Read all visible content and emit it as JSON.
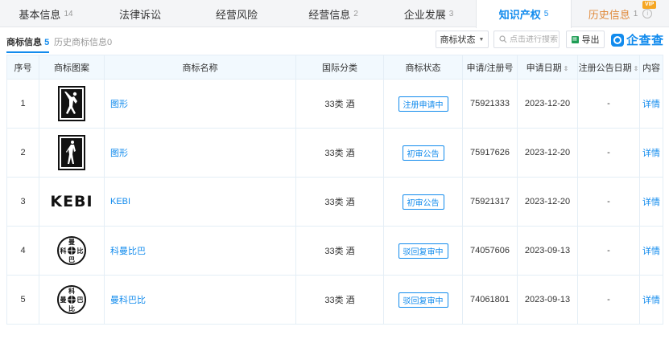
{
  "tabs": [
    {
      "label": "基本信息",
      "count": "14"
    },
    {
      "label": "法律诉讼",
      "count": ""
    },
    {
      "label": "经营风险",
      "count": ""
    },
    {
      "label": "经营信息",
      "count": "2"
    },
    {
      "label": "企业发展",
      "count": "3"
    },
    {
      "label": "知识产权",
      "count": "5",
      "active": true
    },
    {
      "label": "历史信息",
      "count": "1",
      "badge": "VIP"
    }
  ],
  "subtabs": {
    "active_label": "商标信息",
    "active_count": "5",
    "other_label": "历史商标信息",
    "other_count": "0"
  },
  "toolbar": {
    "status_dropdown": "商标状态",
    "search_placeholder": "点击进行搜索",
    "export_label": "导出",
    "brand": "企查查"
  },
  "table": {
    "headers": {
      "index": "序号",
      "image": "商标图案",
      "name": "商标名称",
      "class": "国际分类",
      "status": "商标状态",
      "reg_no": "申请/注册号",
      "apply_date": "申请日期",
      "pub_date": "注册公告日期",
      "content": "内容"
    },
    "rows": [
      {
        "index": "1",
        "logo": "dunk-silhouette-logo",
        "name": "图形",
        "class": "33类 酒",
        "status": "注册申请中",
        "reg_no": "75921333",
        "apply_date": "2023-12-20",
        "pub_date": "-",
        "content": "详情"
      },
      {
        "index": "2",
        "logo": "player-silhouette-logo",
        "name": "图形",
        "class": "33类 酒",
        "status": "初审公告",
        "reg_no": "75917626",
        "apply_date": "2023-12-20",
        "pub_date": "-",
        "content": "详情"
      },
      {
        "index": "3",
        "logo": "kebi-wordmark",
        "logo_text": "KEBI",
        "name": "KEBI",
        "class": "33类 酒",
        "status": "初审公告",
        "reg_no": "75921317",
        "apply_date": "2023-12-20",
        "pub_date": "-",
        "content": "详情"
      },
      {
        "index": "4",
        "logo": "circle-seal-logo",
        "logo_chars": [
          "曼",
          "科",
          "比",
          "巴"
        ],
        "name": "科曼比巴",
        "class": "33类 酒",
        "status": "驳回复审中",
        "reg_no": "74057606",
        "apply_date": "2023-09-13",
        "pub_date": "-",
        "content": "详情"
      },
      {
        "index": "5",
        "logo": "circle-seal-logo",
        "logo_chars": [
          "科",
          "曼",
          "巴",
          "比"
        ],
        "name": "曼科巴比",
        "class": "33类 酒",
        "status": "驳回复审中",
        "reg_no": "74061801",
        "apply_date": "2023-09-13",
        "pub_date": "-",
        "content": "详情"
      }
    ]
  },
  "colors": {
    "accent": "#128bed",
    "header_bg": "#f2f9fe",
    "vip": "#f5a623"
  }
}
